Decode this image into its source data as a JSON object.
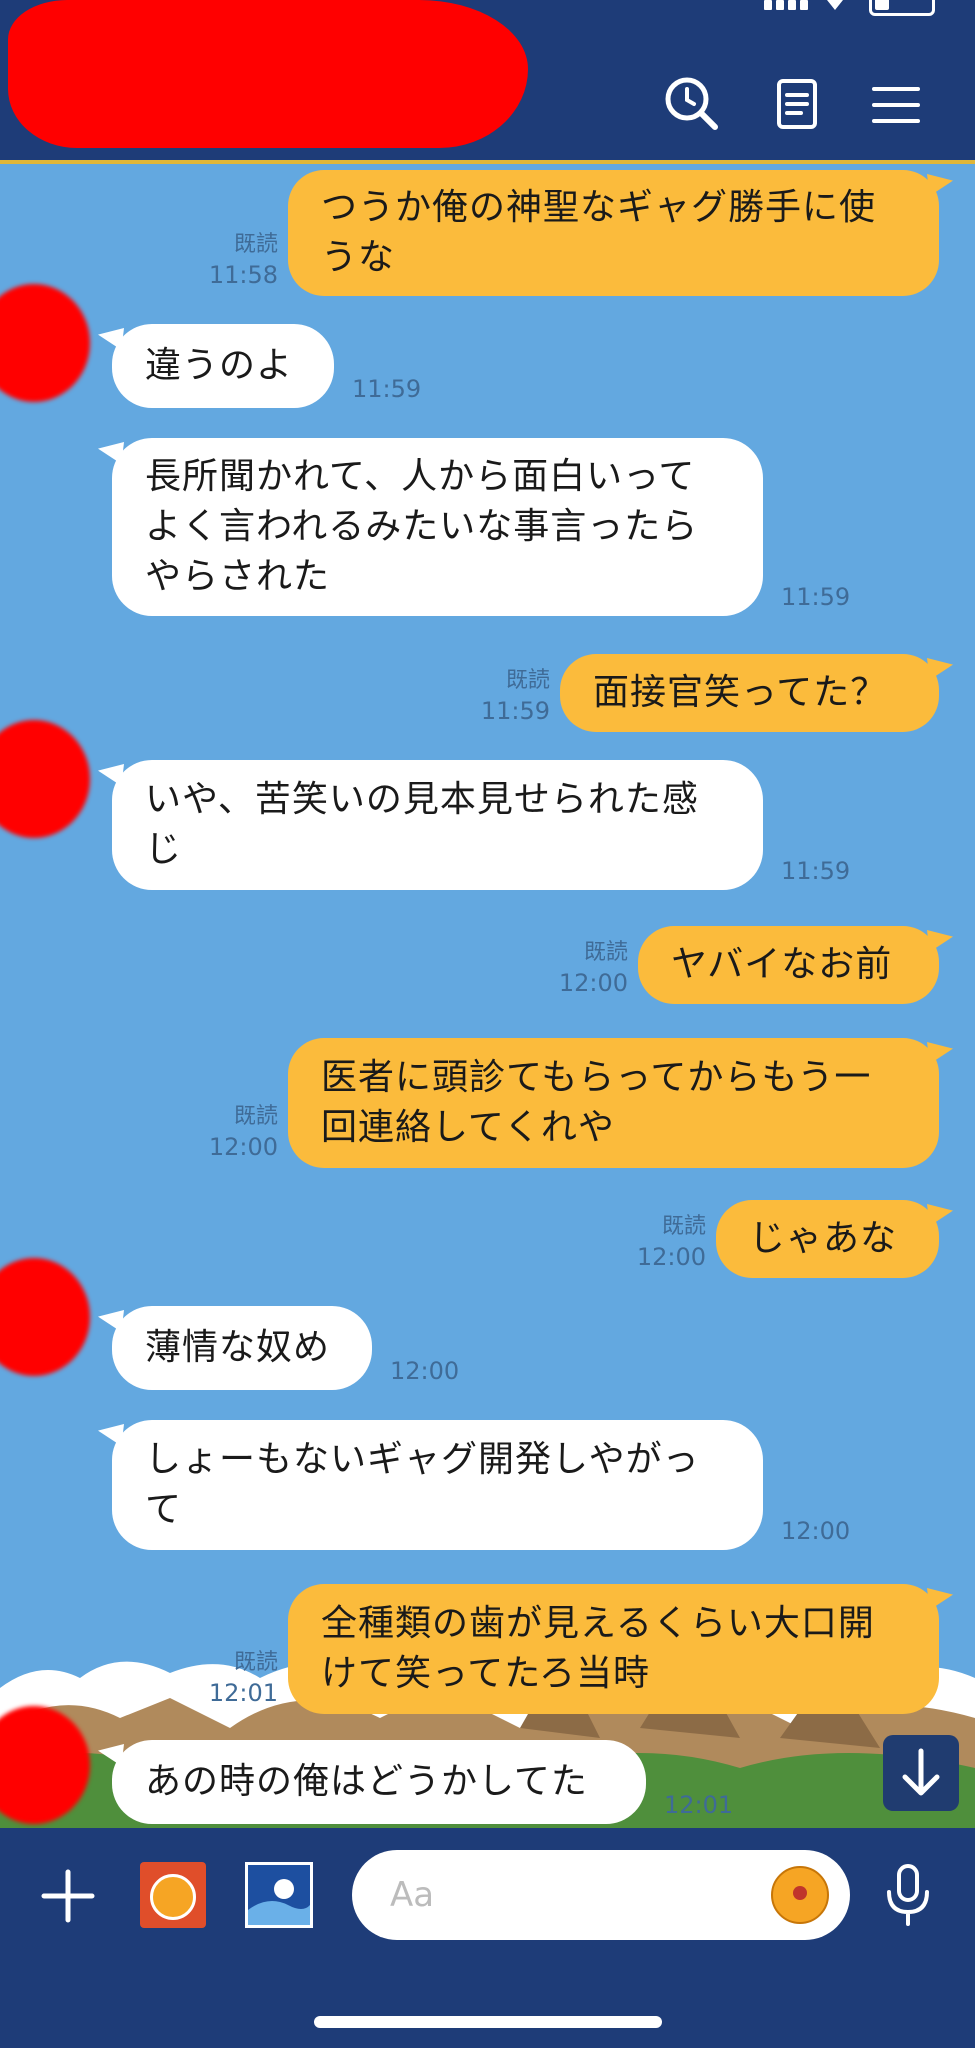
{
  "header": {
    "redacted_name": "",
    "search_icon": "search-clock-icon",
    "notes_icon": "notes-icon",
    "menu_icon": "menu-icon"
  },
  "messages": [
    {
      "side": "out",
      "lines": [
        "つうか俺の神聖なギャグ勝手に使",
        "うな"
      ],
      "read": "既読",
      "time": "11:58"
    },
    {
      "side": "in",
      "lines": [
        "違うのよ"
      ],
      "time": "11:59",
      "avatar": true
    },
    {
      "side": "in",
      "lines": [
        "長所聞かれて、人から面白いって",
        "よく言われるみたいな事言ったら",
        "やらされた"
      ],
      "time": "11:59"
    },
    {
      "side": "out",
      "lines": [
        "面接官笑ってた？"
      ],
      "read": "既読",
      "time": "11:59"
    },
    {
      "side": "in",
      "lines": [
        "いや、苦笑いの見本見せられた感",
        "じ"
      ],
      "time": "11:59",
      "avatar": true
    },
    {
      "side": "out",
      "lines": [
        "ヤバイなお前"
      ],
      "read": "既読",
      "time": "12:00"
    },
    {
      "side": "out",
      "lines": [
        "医者に頭診てもらってからもう一",
        "回連絡してくれや"
      ],
      "read": "既読",
      "time": "12:00"
    },
    {
      "side": "out",
      "lines": [
        "じゃあな"
      ],
      "read": "既読",
      "time": "12:00"
    },
    {
      "side": "in",
      "lines": [
        "薄情な奴め"
      ],
      "time": "12:00",
      "avatar": true
    },
    {
      "side": "in",
      "lines": [
        "しょーもないギャグ開発しやがっ",
        "て"
      ],
      "time": "12:00"
    },
    {
      "side": "out",
      "lines": [
        "全種類の歯が見えるくらい大口開",
        "けて笑ってたろ当時"
      ],
      "read": "既読",
      "time": "12:01"
    },
    {
      "side": "in",
      "lines": [
        "あの時の俺はどうかしてた"
      ],
      "time": "12:01",
      "avatar": true
    }
  ],
  "input": {
    "placeholder": "Aa",
    "plus_icon": "plus-icon",
    "app1_icon": "dragon-ball-app-icon",
    "app2_icon": "image-sticker-icon",
    "emoji_icon": "dragon-ball-emoji-icon",
    "mic_icon": "mic-icon"
  },
  "colors": {
    "header_bg": "#1e3c78",
    "chat_bg": "#63a8e0",
    "outgoing_bubble": "#fbbb3c",
    "incoming_bubble": "#ffffff",
    "meta_text": "#3f6b97",
    "redaction": "#ff0000"
  }
}
